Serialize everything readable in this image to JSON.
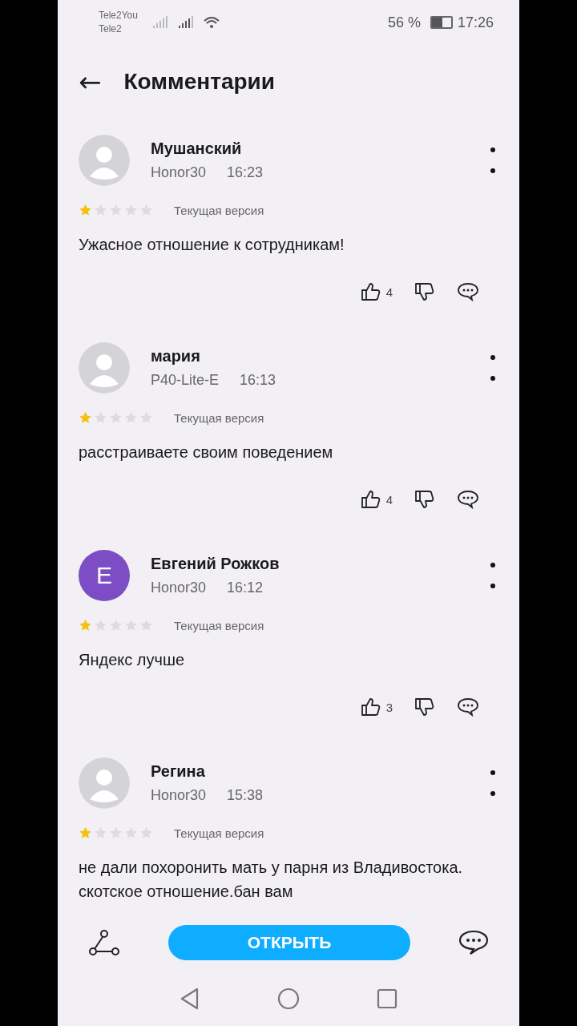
{
  "status_bar": {
    "carrier_1": "Tele2You",
    "carrier_2": "Tele2",
    "battery_text": "56 %",
    "time": "17:26"
  },
  "header": {
    "back": "←",
    "title": "Комментарии"
  },
  "comments": [
    {
      "name": "Мушанский",
      "avatar": {
        "kind": "default"
      },
      "device": "Honor30",
      "time": "16:23",
      "stars": 1,
      "version": "Текущая версия",
      "text": "Ужасное отношение к сотрудникам!",
      "likes": "4"
    },
    {
      "name": "мария",
      "avatar": {
        "kind": "default"
      },
      "device": "P40-Lite-E",
      "time": "16:13",
      "stars": 1,
      "version": "Текущая версия",
      "text": "расстраиваете своим поведением",
      "likes": "4"
    },
    {
      "name": "Евгений Рожков",
      "avatar": {
        "kind": "letter",
        "letter": "E",
        "color": "#7c4dc4"
      },
      "device": "Honor30",
      "time": "16:12",
      "stars": 1,
      "version": "Текущая версия",
      "text": "Яндекс лучше",
      "likes": "3"
    },
    {
      "name": "Регина",
      "avatar": {
        "kind": "default"
      },
      "device": "Honor30",
      "time": "15:38",
      "stars": 1,
      "version": "Текущая версия",
      "text": "не дали похоронить мать у парня из Владивостока.  скотское отношение.бан вам"
    }
  ],
  "bottom_bar": {
    "open_button": "ОТКРЫТЬ"
  }
}
